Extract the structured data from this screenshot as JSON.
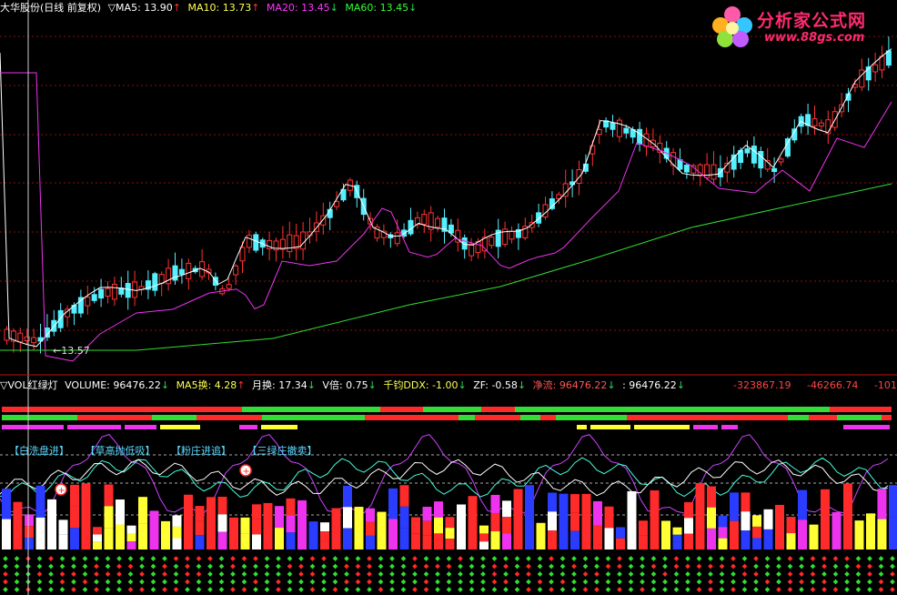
{
  "main_panel": {
    "title": "大华股份(日线 前复权)",
    "ma_items": [
      {
        "label": "▽MA5: 13.90",
        "arrow": "↑",
        "color": "#ffffff"
      },
      {
        "label": "MA10: 13.73",
        "arrow": "↑",
        "color": "#ffff55"
      },
      {
        "label": "MA20: 13.45",
        "arrow": "↓",
        "color": "#ff33ff"
      },
      {
        "label": "MA60: 13.45",
        "arrow": "↓",
        "color": "#33ff33"
      }
    ],
    "low_marker": "13.57"
  },
  "indicator_panel": {
    "items": [
      {
        "label": "▽VOL红绿灯",
        "arrow": "",
        "color": "#ffffff"
      },
      {
        "label": "VOLUME: 96476.22",
        "arrow": "↓",
        "color": "#ffffff"
      },
      {
        "label": "MA5换: 4.28",
        "arrow": "↑",
        "color": "#ffff55"
      },
      {
        "label": "月换: 17.34",
        "arrow": "↓",
        "color": "#ffffff"
      },
      {
        "label": "V倍: 0.75",
        "arrow": "↓",
        "color": "#ffffff"
      },
      {
        "label": "千钧DDX: -1.00",
        "arrow": "↓",
        "color": "#ffff55"
      },
      {
        "label": "ZF: -0.58",
        "arrow": "↓",
        "color": "#ffffff"
      },
      {
        "label": "净流: 96476.22",
        "arrow": "↓",
        "color": "#ff5555"
      },
      {
        "label": ": 96476.22",
        "arrow": "↓",
        "color": "#ffffff"
      }
    ],
    "right_values": [
      "-323867.19",
      "-46266.74",
      "-101"
    ],
    "tags": [
      "【白洗盘进】",
      "【草高抛低吸】",
      "【粉庄进追】",
      "【三绿庄撤卖】"
    ]
  },
  "logo": {
    "title": "分析家公式网",
    "url": "www.88gs.com"
  },
  "colors": {
    "up": "#ff3333",
    "down": "#55f0ff",
    "ma5": "#ffffff",
    "ma20": "#ee33ee",
    "ma60": "#33dd33",
    "grid": "#8a1010"
  }
}
